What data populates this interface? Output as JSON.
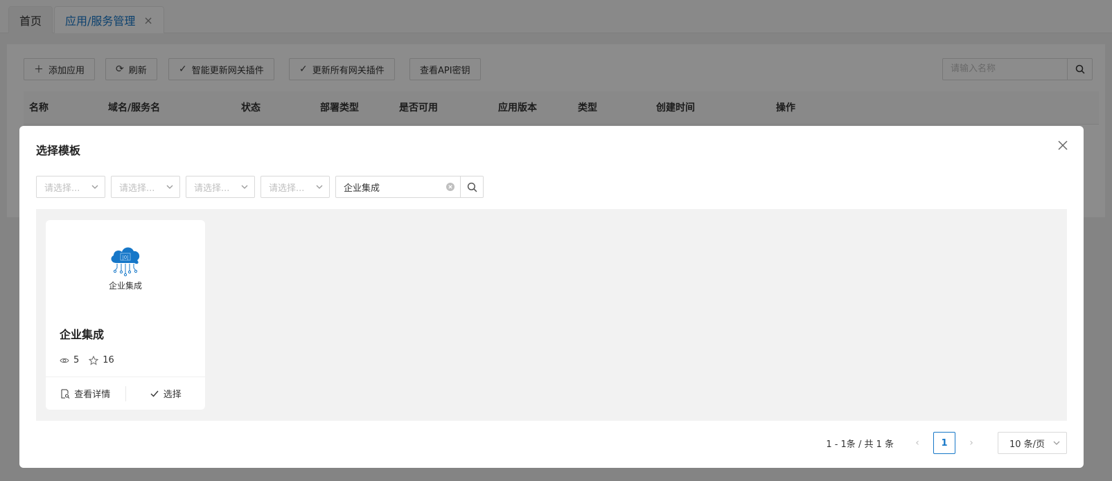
{
  "tabs": [
    {
      "label": "首页"
    },
    {
      "label": "应用/服务管理",
      "close": "×"
    }
  ],
  "toolbar": {
    "add_label": "添加应用",
    "refresh_label": "刷新",
    "smart_update_label": "智能更新网关插件",
    "update_all_label": "更新所有网关插件",
    "view_api_key_label": "查看API密钥",
    "search_placeholder": "请输入名称"
  },
  "table": {
    "columns": [
      "名称",
      "域名/服务名",
      "状态",
      "部署类型",
      "是否可用",
      "应用版本",
      "类型",
      "创建时间",
      "操作"
    ]
  },
  "modal": {
    "title": "选择模板",
    "filters": [
      {
        "placeholder": "请选择..."
      },
      {
        "placeholder": "请选择..."
      },
      {
        "placeholder": "请选择..."
      },
      {
        "placeholder": "请选择..."
      }
    ],
    "keyword": "企业集成",
    "cards": [
      {
        "cover_label": "企业集成",
        "title": "企业集成",
        "views": "5",
        "stars": "16",
        "detail_label": "查看详情",
        "select_label": "选择"
      }
    ],
    "pagination": {
      "total_text": "1 - 1条 / 共 1 条",
      "current_page": "1",
      "page_size": "10 条/页"
    }
  },
  "colors": {
    "accent": "#1677c8",
    "cloud": "#1677c8",
    "mask": "rgba(0,0,0,0.45)"
  }
}
